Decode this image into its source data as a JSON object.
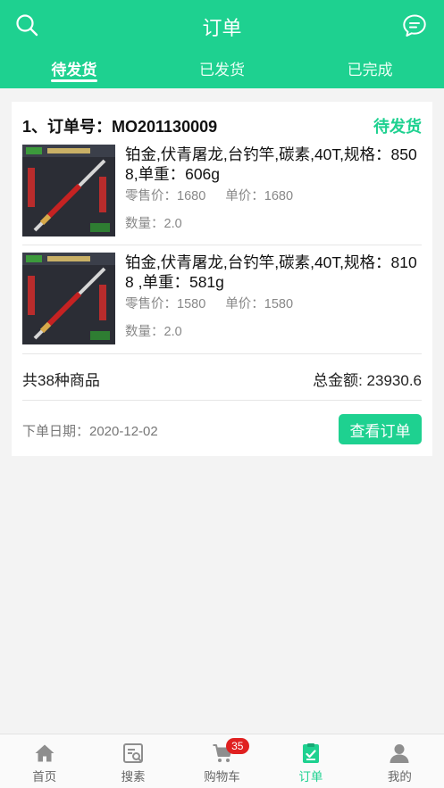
{
  "header": {
    "title": "订单",
    "tabs": [
      {
        "label": "待发货",
        "active": true
      },
      {
        "label": "已发货",
        "active": false
      },
      {
        "label": "已完成",
        "active": false
      }
    ]
  },
  "colors": {
    "accent": "#1ed190",
    "badge": "#e02020"
  },
  "order": {
    "number_label": "1、订单号：MO201130009",
    "status": "待发货",
    "items": [
      {
        "name": "铂金,伏青屠龙,台钓竿,碳素,40T,规格：8508,单重：606g",
        "retail_price": "零售价：1680",
        "unit_price": "单价：1680",
        "quantity": "数量：2.0"
      },
      {
        "name": "铂金,伏青屠龙,台钓竿,碳素,40T,规格：8108 ,单重：581g",
        "retail_price": "零售价：1580",
        "unit_price": "单价：1580",
        "quantity": "数量：2.0"
      }
    ],
    "product_count": "共38种商品",
    "total": "总金额: 23930.6",
    "order_date": "下单日期：2020-12-02",
    "view_button": "查看订单"
  },
  "bottom_nav": [
    {
      "label": "首页",
      "icon": "home-icon"
    },
    {
      "label": "搜素",
      "icon": "scan-icon"
    },
    {
      "label": "购物车",
      "icon": "cart-icon",
      "badge": "35"
    },
    {
      "label": "订单",
      "icon": "order-icon",
      "active": true
    },
    {
      "label": "我的",
      "icon": "user-icon"
    }
  ]
}
